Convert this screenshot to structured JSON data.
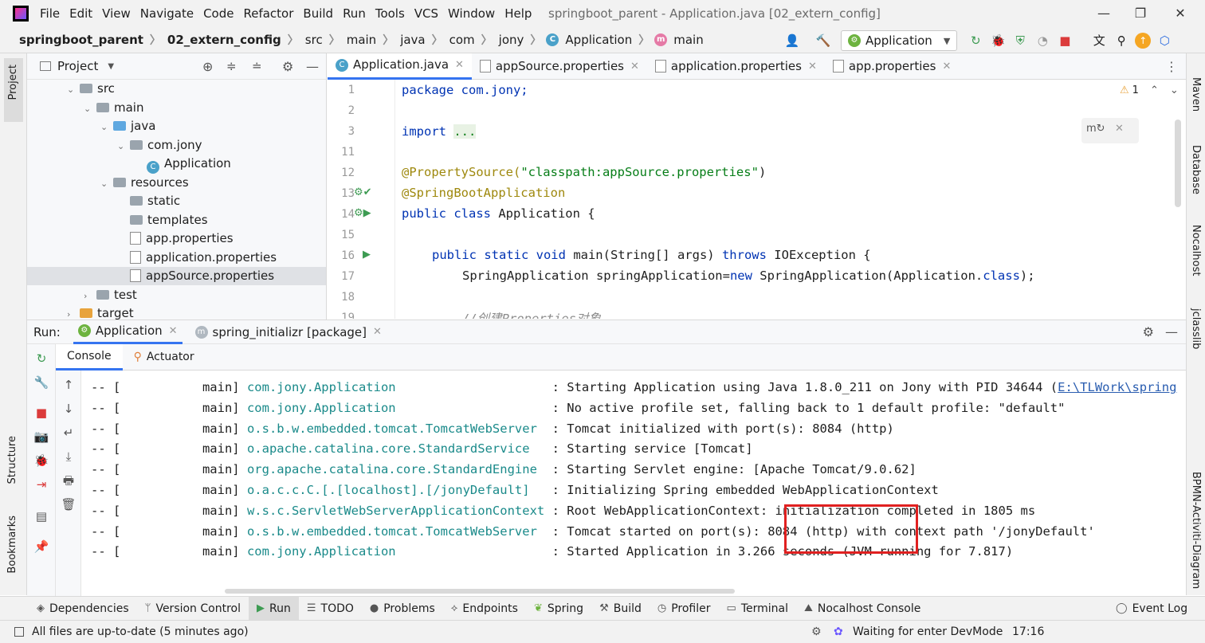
{
  "menu": {
    "items": [
      "File",
      "Edit",
      "View",
      "Navigate",
      "Code",
      "Refactor",
      "Build",
      "Run",
      "Tools",
      "VCS",
      "Window",
      "Help"
    ],
    "window_title": "springboot_parent - Application.java [02_extern_config]"
  },
  "nav": {
    "breadcrumbs": [
      "springboot_parent",
      "02_extern_config",
      "src",
      "main",
      "java",
      "com",
      "jony",
      "Application",
      "main"
    ],
    "run_config": "Application"
  },
  "project": {
    "title": "Project",
    "tree": [
      {
        "label": "src",
        "kind": "folder",
        "depth": 0,
        "open": true
      },
      {
        "label": "main",
        "kind": "folder",
        "depth": 1,
        "open": true
      },
      {
        "label": "java",
        "kind": "folder-blue",
        "depth": 2,
        "open": true
      },
      {
        "label": "com.jony",
        "kind": "folder",
        "depth": 3,
        "open": true
      },
      {
        "label": "Application",
        "kind": "class",
        "depth": 4
      },
      {
        "label": "resources",
        "kind": "folder",
        "depth": 2,
        "open": true
      },
      {
        "label": "static",
        "kind": "folder",
        "depth": 3
      },
      {
        "label": "templates",
        "kind": "folder",
        "depth": 3
      },
      {
        "label": "app.properties",
        "kind": "file",
        "depth": 3
      },
      {
        "label": "application.properties",
        "kind": "file",
        "depth": 3
      },
      {
        "label": "appSource.properties",
        "kind": "file",
        "depth": 3,
        "selected": true
      },
      {
        "label": "test",
        "kind": "folder",
        "depth": 1,
        "open": false
      },
      {
        "label": "target",
        "kind": "folder-orange",
        "depth": 0,
        "open": false
      }
    ]
  },
  "editor": {
    "tabs": [
      "Application.java",
      "appSource.properties",
      "application.properties",
      "app.properties"
    ],
    "warnings": "1",
    "line_numbers": [
      "1",
      "2",
      "3",
      "11",
      "12",
      "13",
      "14",
      "15",
      "16",
      "17",
      "18",
      "19"
    ],
    "code": {
      "l1": "package com.jony;",
      "l3_kw": "import",
      "l3_fold": "...",
      "l12_ann": "@PropertySource(",
      "l12_str": "\"classpath:appSource.properties\"",
      "l12_end": ")",
      "l13_ann": "@SpringBootApplication",
      "l14_kw": "public class",
      "l14_rest": " Application {",
      "l16_kw": "public static void",
      "l16_mid": " main(String[] args) ",
      "l16_kw2": "throws",
      "l16_rest": " IOException {",
      "l17_a": "SpringApplication springApplication=",
      "l17_kw": "new",
      "l17_b": " SpringApplication(Application.",
      "l17_kw2": "class",
      "l17_c": ");",
      "l19": "//创建Properties对象"
    }
  },
  "run": {
    "label": "Run:",
    "tabs": [
      "Application",
      "spring_initializr [package]"
    ],
    "subtabs": [
      "Console",
      "Actuator"
    ],
    "console": [
      {
        "prefix": "-- [           main] ",
        "logger": "com.jony.Application                    ",
        "msg": " : Starting Application using Java 1.8.0_211 on Jony with PID 34644 (",
        "link": "E:\\TLWork\\spring"
      },
      {
        "prefix": "-- [           main] ",
        "logger": "com.jony.Application                    ",
        "msg": " : No active profile set, falling back to 1 default profile: \"default\""
      },
      {
        "prefix": "-- [           main] ",
        "logger": "o.s.b.w.embedded.tomcat.TomcatWebServer ",
        "msg": " : Tomcat initialized with port(s): 8084 (http)"
      },
      {
        "prefix": "-- [           main] ",
        "logger": "o.apache.catalina.core.StandardService  ",
        "msg": " : Starting service [Tomcat]"
      },
      {
        "prefix": "-- [           main] ",
        "logger": "org.apache.catalina.core.StandardEngine ",
        "msg": " : Starting Servlet engine: [Apache Tomcat/9.0.62]"
      },
      {
        "prefix": "-- [           main] ",
        "logger": "o.a.c.c.C.[.[localhost].[/jonyDefault]  ",
        "msg": " : Initializing Spring embedded WebApplicationContext"
      },
      {
        "prefix": "-- [           main] ",
        "logger": "w.s.c.ServletWebServerApplicationContext",
        "msg": " : Root WebApplicationContext: initialization completed in 1805 ms"
      },
      {
        "prefix": "-- [           main] ",
        "logger": "o.s.b.w.embedded.tomcat.TomcatWebServer ",
        "msg": " : Tomcat started on port(s): 8084 (http) with context path '/jonyDefault'"
      },
      {
        "prefix": "-- [           main] ",
        "logger": "com.jony.Application                    ",
        "msg": " : Started Application in 3.266 seconds (JVM running for 7.817)"
      }
    ]
  },
  "stripes": {
    "left": [
      "Project",
      "Structure",
      "Bookmarks"
    ],
    "right": [
      "Maven",
      "Database",
      "Nocalhost",
      "jclasslib",
      "BPMN-Activiti-Diagram"
    ]
  },
  "bottom_tools": [
    "Dependencies",
    "Version Control",
    "Run",
    "TODO",
    "Problems",
    "Endpoints",
    "Spring",
    "Build",
    "Profiler",
    "Terminal",
    "Nocalhost Console",
    "Event Log"
  ],
  "status": {
    "left": "All files are up-to-date (5 minutes ago)",
    "devmode": "Waiting for enter DevMode",
    "time": "17:16"
  },
  "colors": {
    "accent": "#3574f0",
    "highlight_box": "#e02020",
    "logger": "#1a8a8a"
  }
}
